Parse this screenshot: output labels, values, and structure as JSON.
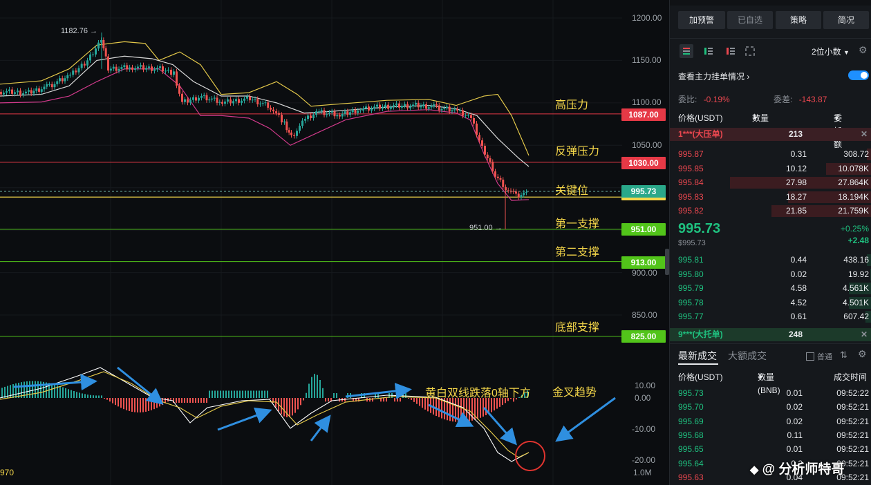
{
  "chart": {
    "price_axis": [
      "1200.00",
      "1150.00",
      "1100.00",
      "1050.00",
      "900.00",
      "850.00"
    ],
    "macd_axis": [
      "10.00",
      "0.00",
      "-10.00",
      "-20.00"
    ],
    "volume_label": "1.0M",
    "left_edge_value": "970",
    "high_label": "1182.76",
    "low_label": "951.00",
    "levels": [
      {
        "price": "1087.00",
        "label": "高压力",
        "color": "#e63946"
      },
      {
        "price": "1030.00",
        "label": "反弹压力",
        "color": "#e63946"
      },
      {
        "price": "995.73",
        "label": "关键位",
        "color": "#2aa88a"
      },
      {
        "price": "951.00",
        "label": "第一支撑",
        "color": "#52c41a"
      },
      {
        "price": "913.00",
        "label": "第二支撑",
        "color": "#52c41a"
      },
      {
        "price": "825.00",
        "label": "底部支撑",
        "color": "#52c41a"
      }
    ],
    "annotations": {
      "macd_note": "黄白双线跌落0轴下方",
      "golden_cross": "金叉趋势"
    }
  },
  "panel": {
    "top_buttons": [
      "加预警",
      "已自选",
      "策略",
      "简况"
    ],
    "decimals": "2位小数",
    "main_orders_label": "查看主力挂单情况",
    "ratio_label": "委比:",
    "ratio_value": "-0.19%",
    "diff_label": "委差:",
    "diff_value": "-143.87",
    "col_price": "价格(USDT)",
    "col_qty": "数量 (BNB)",
    "col_total": "委托额",
    "big_ask": {
      "label": "1***(大压单)",
      "value": "213"
    },
    "asks": [
      {
        "price": "995.87",
        "qty": "0.31",
        "total": "308.72",
        "depth": 0.03
      },
      {
        "price": "995.85",
        "qty": "10.12",
        "total": "10.078K",
        "depth": 0.3
      },
      {
        "price": "995.84",
        "qty": "27.98",
        "total": "27.864K",
        "depth": 0.93
      },
      {
        "price": "995.83",
        "qty": "18.27",
        "total": "18.194K",
        "depth": 0.55
      },
      {
        "price": "995.82",
        "qty": "21.85",
        "total": "21.759K",
        "depth": 0.66
      }
    ],
    "last_price": "995.73",
    "last_price_usd": "$995.73",
    "change_pct": "+0.25%",
    "change_abs": "+2.48",
    "bids": [
      {
        "price": "995.81",
        "qty": "0.44",
        "total": "438.16",
        "depth": 0.03
      },
      {
        "price": "995.80",
        "qty": "0.02",
        "total": "19.92",
        "depth": 0.01
      },
      {
        "price": "995.79",
        "qty": "4.58",
        "total": "4.561K",
        "depth": 0.15
      },
      {
        "price": "995.78",
        "qty": "4.52",
        "total": "4.501K",
        "depth": 0.15
      },
      {
        "price": "995.77",
        "qty": "0.61",
        "total": "607.42",
        "depth": 0.04
      }
    ],
    "big_bid": {
      "label": "9***(大托单)",
      "value": "248"
    },
    "trade_tabs": [
      "最新成交",
      "大额成交"
    ],
    "normal_label": "普通",
    "trade_cols": [
      "价格(USDT)",
      "数量(BNB)",
      "成交时间"
    ],
    "trades": [
      {
        "price": "995.73",
        "qty": "0.01",
        "time": "09:52:22",
        "side": "buy"
      },
      {
        "price": "995.70",
        "qty": "0.02",
        "time": "09:52:21",
        "side": "buy"
      },
      {
        "price": "995.69",
        "qty": "0.02",
        "time": "09:52:21",
        "side": "buy"
      },
      {
        "price": "995.68",
        "qty": "0.11",
        "time": "09:52:21",
        "side": "buy"
      },
      {
        "price": "995.65",
        "qty": "0.01",
        "time": "09:52:21",
        "side": "buy"
      },
      {
        "price": "995.64",
        "qty": "0.2",
        "time": "09:52:21",
        "side": "buy"
      },
      {
        "price": "995.63",
        "qty": "0.04",
        "time": "09:52:21",
        "side": "sell"
      }
    ],
    "watermark": "@ 分析师特哥"
  }
}
